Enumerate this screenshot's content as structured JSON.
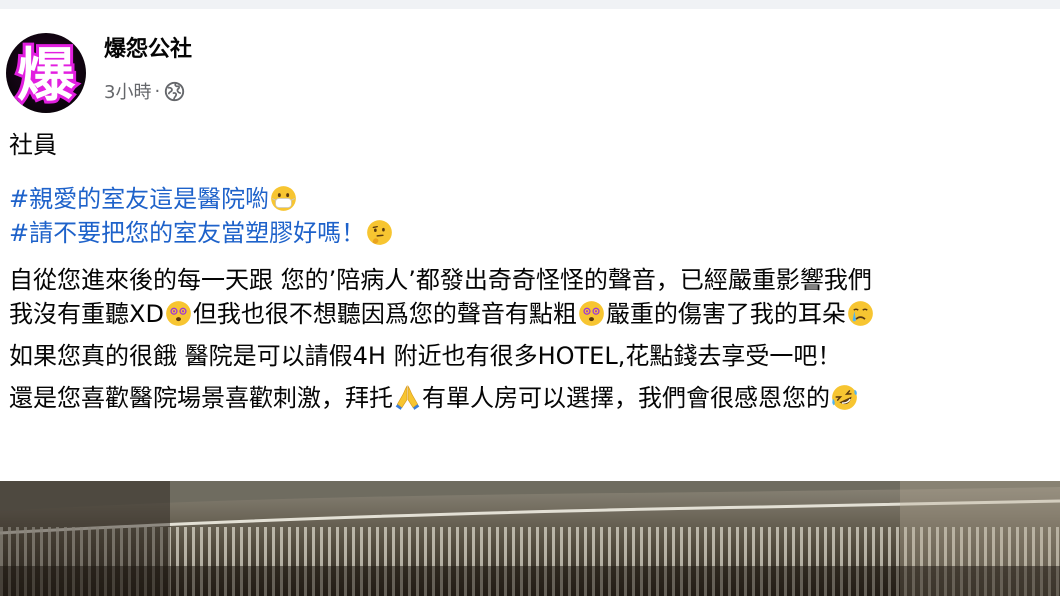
{
  "post": {
    "author": "爆怨公社",
    "avatar_text": "爆",
    "timestamp": "3小時",
    "separator": "·",
    "privacy_icon": "globe-icon",
    "lines": {
      "l1": "社員",
      "l2": "#親愛的室友這是醫院喲",
      "l3": "#請不要把您的室友當塑膠好嗎！",
      "l4": "自從您進來後的每一天跟 您的’陪病人’都發出奇奇怪怪的聲音，已經嚴重影響我們",
      "l5a": "我沒有重聽XD",
      "l5b": "但我也很不想聽因爲您的聲音有點粗",
      "l5c": "嚴重的傷害了我的耳朵",
      "l6": "如果您真的很餓 醫院是可以請假4H 附近也有很多HOTEL,花點錢去享受一吧！",
      "l7a": "還是您喜歡醫院場景喜歡刺激，拜托",
      "l7b": "有單人房可以選擇，我們會很感恩您的"
    },
    "emojis": {
      "mask": "face-with-medical-mask-icon",
      "thinking": "thinking-face-icon",
      "dizzy1": "face-with-spiral-eyes-icon",
      "dizzy2": "face-with-spiral-eyes-icon",
      "crying": "crying-face-icon",
      "pray": "folded-hands-icon",
      "laughing": "rolling-on-floor-laughing-icon"
    }
  },
  "colors": {
    "hashtag": "#1e62ca",
    "meta": "#65676b",
    "text": "#050505",
    "avatar_glyph": "#e21fe0"
  }
}
